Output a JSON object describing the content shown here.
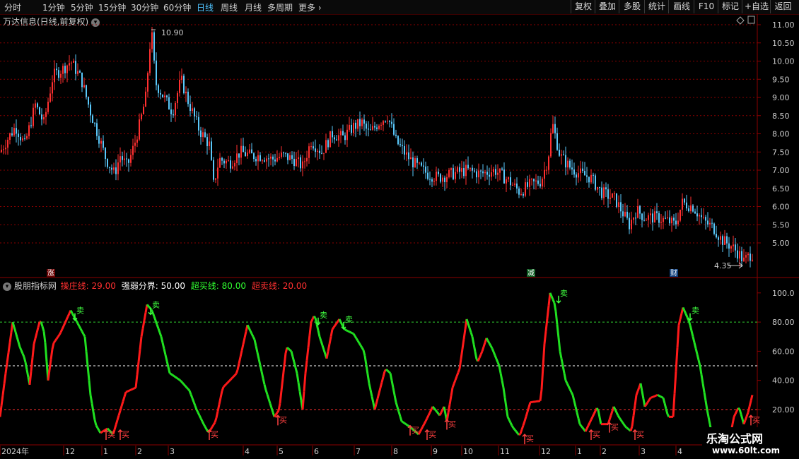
{
  "toolbar": {
    "periods": [
      "分时",
      "1分钟",
      "5分钟",
      "15分钟",
      "30分钟",
      "60分钟",
      "日线",
      "周线",
      "月线",
      "多周期",
      "更多"
    ],
    "active_period": "日线",
    "buttons": [
      "复权",
      "叠加",
      "多股",
      "统计",
      "画线",
      "F10",
      "标记",
      "+自选",
      "返回"
    ]
  },
  "main_panel": {
    "title": "万达信息(日线,前复权)",
    "y_ticks": [
      "11.00",
      "10.50",
      "10.00",
      "9.50",
      "9.00",
      "8.50",
      "8.00",
      "7.50",
      "7.00",
      "6.50",
      "6.00",
      "5.50",
      "5.00"
    ],
    "high_label": "10.90",
    "low_label": "4.35",
    "events": [
      "涨",
      "减",
      "财"
    ]
  },
  "indicator_panel": {
    "title": "股朋指标网",
    "params": [
      {
        "label": "操庄线:",
        "value": "29.00",
        "color": "#ff3030"
      },
      {
        "label": "强弱分界:",
        "value": "50.00",
        "color": "#ffffff"
      },
      {
        "label": "超买线:",
        "value": "80.00",
        "color": "#30ff30"
      },
      {
        "label": "超卖线:",
        "value": "20.00",
        "color": "#ff3030"
      }
    ],
    "y_ticks": [
      "100.0",
      "80.00",
      "60.00",
      "40.00",
      "20.00"
    ],
    "sell_label": "卖",
    "buy_label": "买"
  },
  "x_axis": {
    "labels": [
      "2024年",
      "12",
      "1",
      "2",
      "3",
      "4",
      "5",
      "6",
      "7",
      "8",
      "9",
      "10",
      "11",
      "12",
      "1",
      "2",
      "3",
      "4",
      "5"
    ]
  },
  "watermark": {
    "title": "乐淘公式网",
    "url": "www.60lt.com"
  },
  "colors": {
    "up": "#ff3030",
    "down": "#5ac8fa",
    "grid": "#8b0000",
    "ind_up": "#ff1a1a",
    "ind_down": "#20e020"
  }
}
